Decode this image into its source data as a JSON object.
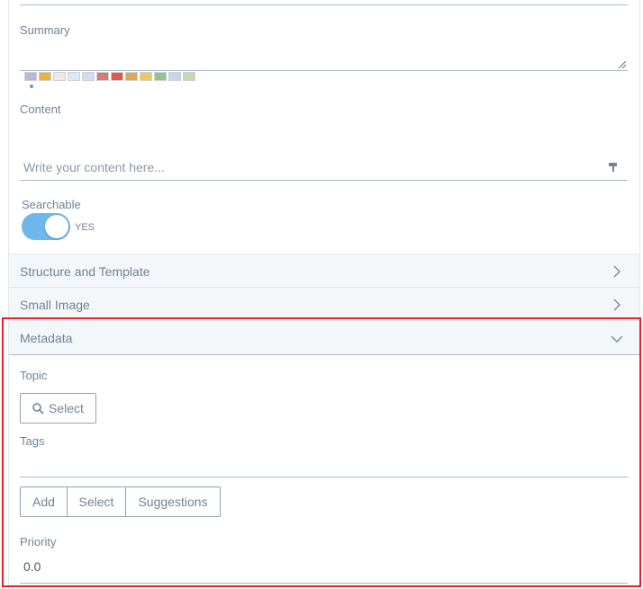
{
  "summary": {
    "label": "Summary"
  },
  "flags": [
    "en-US",
    "es-ES",
    "ja-JP",
    "he-IL",
    "fi-FI",
    "nl-NL",
    "zh-CN",
    "de-DE",
    "ca-ES",
    "pt-BR",
    "fr-FR",
    "hu-HU"
  ],
  "flag_colors": [
    "#b5b9d8",
    "#e9b13e",
    "#f2e7e7",
    "#dce8f5",
    "#cfdff0",
    "#d77a7a",
    "#e05a4a",
    "#d9a85c",
    "#f1c65c",
    "#8ec58e",
    "#c9d3ee",
    "#c5d8b1"
  ],
  "content": {
    "label": "Content",
    "placeholder": "Write your content here..."
  },
  "searchable": {
    "label": "Searchable",
    "toggle_text": "YES"
  },
  "panels": {
    "structure": "Structure and Template",
    "small_image": "Small Image",
    "metadata": "Metadata"
  },
  "metadata": {
    "topic_label": "Topic",
    "topic_select": "Select",
    "tags_label": "Tags",
    "tag_buttons": {
      "add": "Add",
      "select": "Select",
      "suggestions": "Suggestions"
    },
    "priority_label": "Priority",
    "priority_value": "0.0"
  },
  "colors": {
    "accent": "#6fb6ea",
    "highlight": "#e0242b",
    "panel_bg": "#f4f7f9"
  }
}
